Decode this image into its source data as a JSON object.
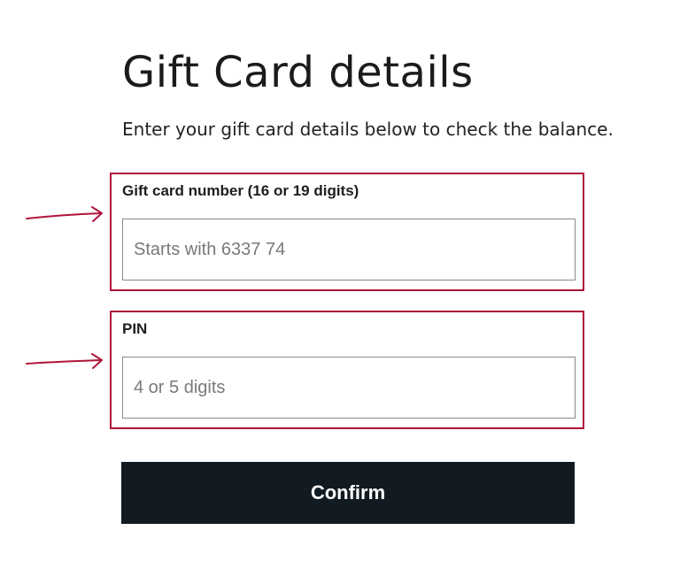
{
  "page": {
    "title": "Gift Card details",
    "intro": "Enter your gift card details below to check the balance."
  },
  "form": {
    "card_number": {
      "label": "Gift card number (16 or 19 digits)",
      "placeholder": "Starts with 6337 74",
      "value": ""
    },
    "pin": {
      "label": "PIN",
      "placeholder": "4 or 5 digits",
      "value": ""
    },
    "confirm_label": "Confirm"
  },
  "colors": {
    "highlight": "#b0143a",
    "button_bg": "#121b22",
    "button_text": "#ffffff"
  },
  "icons": [
    "arrow-right-annotation-icon"
  ]
}
